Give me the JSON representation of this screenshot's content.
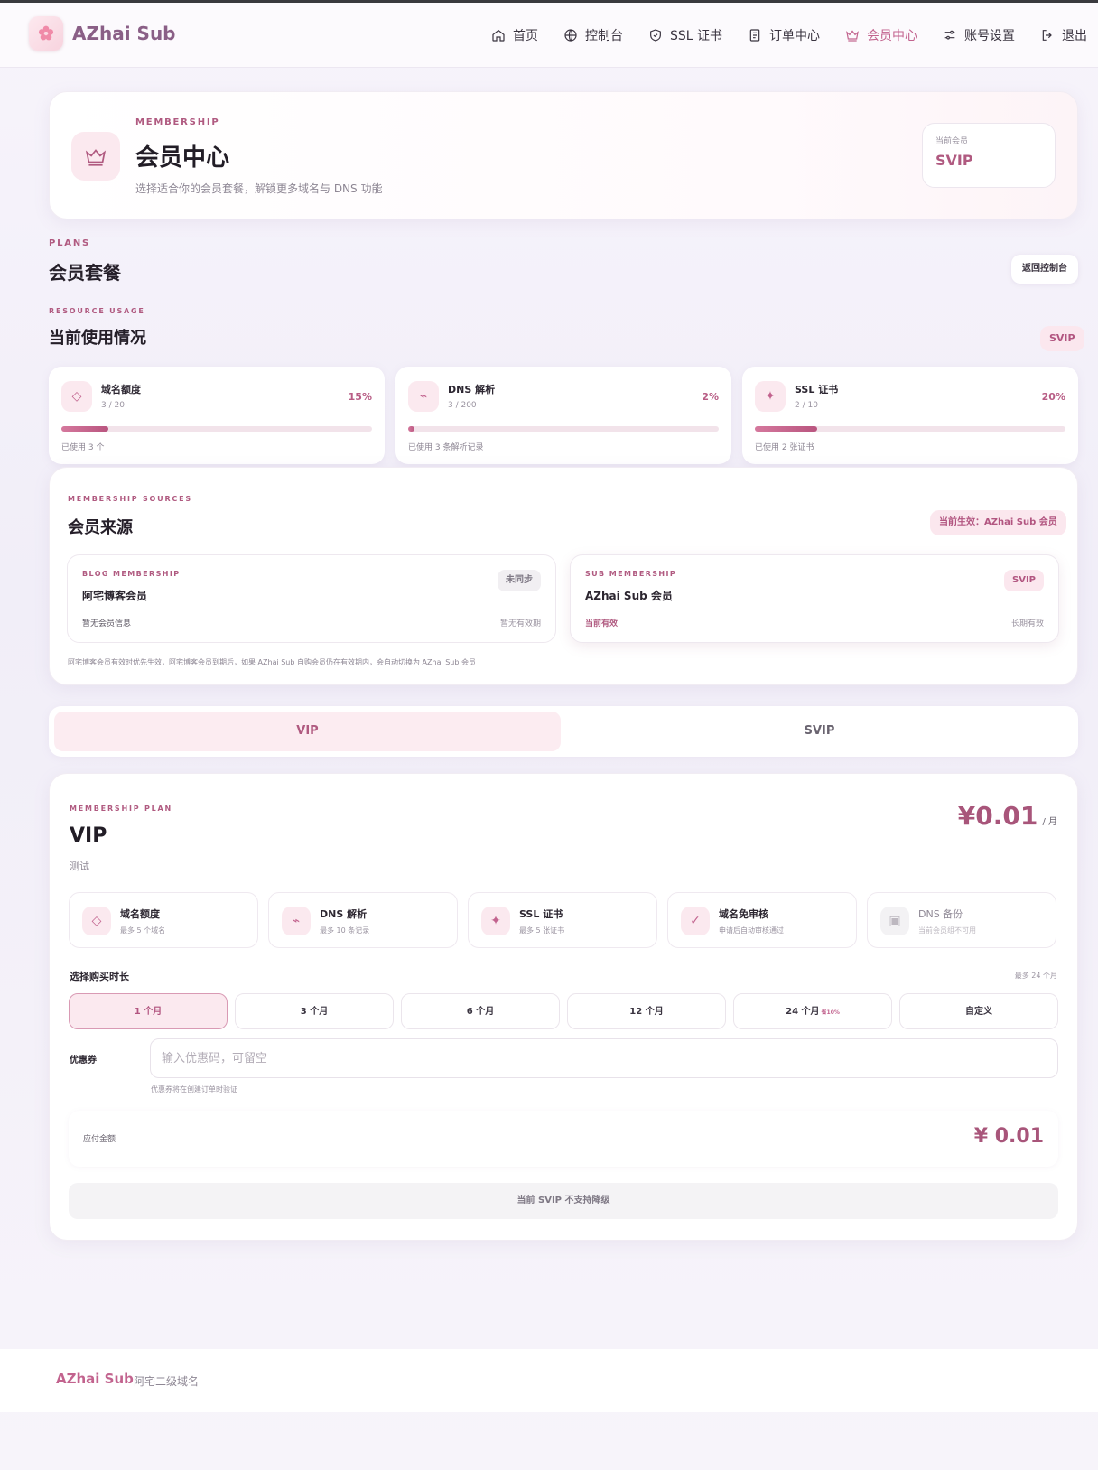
{
  "brand": {
    "name": "AZhai Sub"
  },
  "nav": [
    {
      "label": "首页",
      "icon": "home-icon"
    },
    {
      "label": "控制台",
      "icon": "globe-icon"
    },
    {
      "label": "SSL 证书",
      "icon": "shield-icon"
    },
    {
      "label": "订单中心",
      "icon": "document-icon"
    },
    {
      "label": "会员中心",
      "icon": "crown-icon",
      "active": true
    },
    {
      "label": "账号设置",
      "icon": "settings-icon"
    },
    {
      "label": "退出",
      "icon": "logout-icon"
    }
  ],
  "hero": {
    "eyebrow": "MEMBERSHIP",
    "title": "会员中心",
    "subtitle": "选择适合你的会员套餐，解锁更多域名与 DNS 功能",
    "current_label": "当前会员",
    "current_value": "SVIP"
  },
  "plans_section": {
    "eyebrow": "PLANS",
    "title": "会员套餐",
    "back_button": "返回控制台"
  },
  "usage": {
    "eyebrow": "RESOURCE USAGE",
    "title": "当前使用情况",
    "badge": "SVIP",
    "items": [
      {
        "name": "域名额度",
        "count": "3 / 20",
        "percent_label": "15%",
        "percent": 15,
        "note": "已使用 3 个",
        "icon": "diamond-icon"
      },
      {
        "name": "DNS 解析",
        "count": "3 / 200",
        "percent_label": "2%",
        "percent": 2,
        "note": "已使用 3 条解析记录",
        "icon": "bolt-icon"
      },
      {
        "name": "SSL 证书",
        "count": "2 / 10",
        "percent_label": "20%",
        "percent": 20,
        "note": "已使用 2 张证书",
        "icon": "sparkle-icon"
      }
    ]
  },
  "sources": {
    "eyebrow": "MEMBERSHIP SOURCES",
    "title": "会员来源",
    "active_badge": "当前生效：AZhai Sub 会员",
    "blog": {
      "eyebrow": "BLOG MEMBERSHIP",
      "title": "阿宅博客会员",
      "badge": "未同步",
      "left": "暂无会员信息",
      "right": "暂无有效期"
    },
    "sub": {
      "eyebrow": "SUB MEMBERSHIP",
      "title": "AZhai Sub 会员",
      "badge": "SVIP",
      "left": "当前有效",
      "right": "长期有效"
    },
    "footnote": "阿宅博客会员有效时优先生效，阿宅博客会员到期后，如果 AZhai Sub 自购会员仍在有效期内，会自动切换为 AZhai Sub 会员"
  },
  "tabs": [
    {
      "label": "VIP",
      "active": true
    },
    {
      "label": "SVIP",
      "active": false
    }
  ],
  "plan": {
    "eyebrow": "MEMBERSHIP PLAN",
    "name": "VIP",
    "desc": "测试",
    "price": "¥0.01",
    "unit": "/ 月",
    "features": [
      {
        "name": "域名额度",
        "desc": "最多 5 个域名",
        "icon": "diamond-icon"
      },
      {
        "name": "DNS 解析",
        "desc": "最多 10 条记录",
        "icon": "bolt-icon"
      },
      {
        "name": "SSL 证书",
        "desc": "最多 5 张证书",
        "icon": "sparkle-icon"
      },
      {
        "name": "域名免审核",
        "desc": "申请后自动审核通过",
        "icon": "check-icon"
      },
      {
        "name": "DNS 备份",
        "desc": "当前会员组不可用",
        "icon": "backup-icon",
        "disabled": true
      }
    ]
  },
  "duration": {
    "label": "选择购买时长",
    "hint": "最多 24 个月",
    "options": [
      {
        "label": "1 个月",
        "active": true,
        "save": ""
      },
      {
        "label": "3 个月",
        "save": ""
      },
      {
        "label": "6 个月",
        "save": ""
      },
      {
        "label": "12 个月",
        "save": ""
      },
      {
        "label": "24 个月",
        "save": "省10%"
      },
      {
        "label": "自定义",
        "save": ""
      }
    ]
  },
  "coupon": {
    "label": "优惠券",
    "placeholder": "输入优惠码，可留空",
    "value": "",
    "hint": "优惠券将在创建订单时验证"
  },
  "payment": {
    "label": "应付金额",
    "amount": "¥ 0.01"
  },
  "submit": {
    "label": "当前 SVIP 不支持降级"
  },
  "footer": {
    "brand": "AZhai Sub",
    "tagline": "阿宅二级域名"
  },
  "colors": {
    "accent": "#b05a80",
    "brand": "#8a5f86",
    "accent_light": "#fbe9ef"
  }
}
